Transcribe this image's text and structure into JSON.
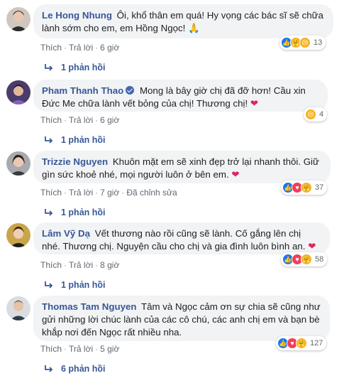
{
  "comments": [
    {
      "name": "Le Hong Nhung",
      "text": "Ôi, khổ thân em quá! Hy vọng các bác sĩ sẽ chữa lành sớm cho em, em Hồng Ngọc!",
      "emoji": "🙏",
      "verified": false,
      "like_label": "Thích",
      "reply_label": "Trả lời",
      "time": "6 giờ",
      "edited": "",
      "reactions": [
        "like",
        "care",
        "sad"
      ],
      "reaction_count": "13",
      "replies": "1 phản hồi"
    },
    {
      "name": "Pham Thanh Thao",
      "text": "Mong là bây giờ chị đã đỡ hơn! Cầu xin Đức Me chữa lành vết bỏng của chị! Thương chị!",
      "emoji": "❤",
      "verified": true,
      "like_label": "Thích",
      "reply_label": "Trả lời",
      "time": "6 giờ",
      "edited": "",
      "reactions": [
        "sad"
      ],
      "reaction_count": "4",
      "replies": "1 phản hồi"
    },
    {
      "name": "Trizzie Nguyen",
      "text": "Khuôn mặt em sẽ xinh đẹp trở lại nhanh thôi. Giữ gìn sức khoẻ nhé, mọi người luôn ở bên em.",
      "emoji": "❤",
      "verified": false,
      "like_label": "Thích",
      "reply_label": "Trả lời",
      "time": "7 giờ",
      "edited": "Đã chỉnh sửa",
      "reactions": [
        "like",
        "love",
        "care"
      ],
      "reaction_count": "37",
      "replies": "1 phản hồi"
    },
    {
      "name": "Lâm Vỹ Dạ",
      "text": "Vết thương nào rồi cũng sẽ lành. Cố gắng lên chị nhé. Thương chị. Nguyện cầu cho chị và gia đình luôn bình an.",
      "emoji": "❤",
      "verified": false,
      "like_label": "Thích",
      "reply_label": "Trả lời",
      "time": "8 giờ",
      "edited": "",
      "reactions": [
        "like",
        "love",
        "care"
      ],
      "reaction_count": "58",
      "replies": "1 phản hồi"
    },
    {
      "name": "Thomas Tam Nguyen",
      "text": "Tâm và Ngọc cảm ơn sự chia sẽ cũng như gửi những lời chúc lành của các cô chú, các anh chị em và bạn bè khắp nơi đến Ngọc rất nhiều nha.",
      "emoji": "",
      "verified": false,
      "like_label": "Thích",
      "reply_label": "Trả lời",
      "time": "5 giờ",
      "edited": "",
      "reactions": [
        "like",
        "love",
        "care"
      ],
      "reaction_count": "127",
      "replies": "6 phản hồi"
    }
  ]
}
